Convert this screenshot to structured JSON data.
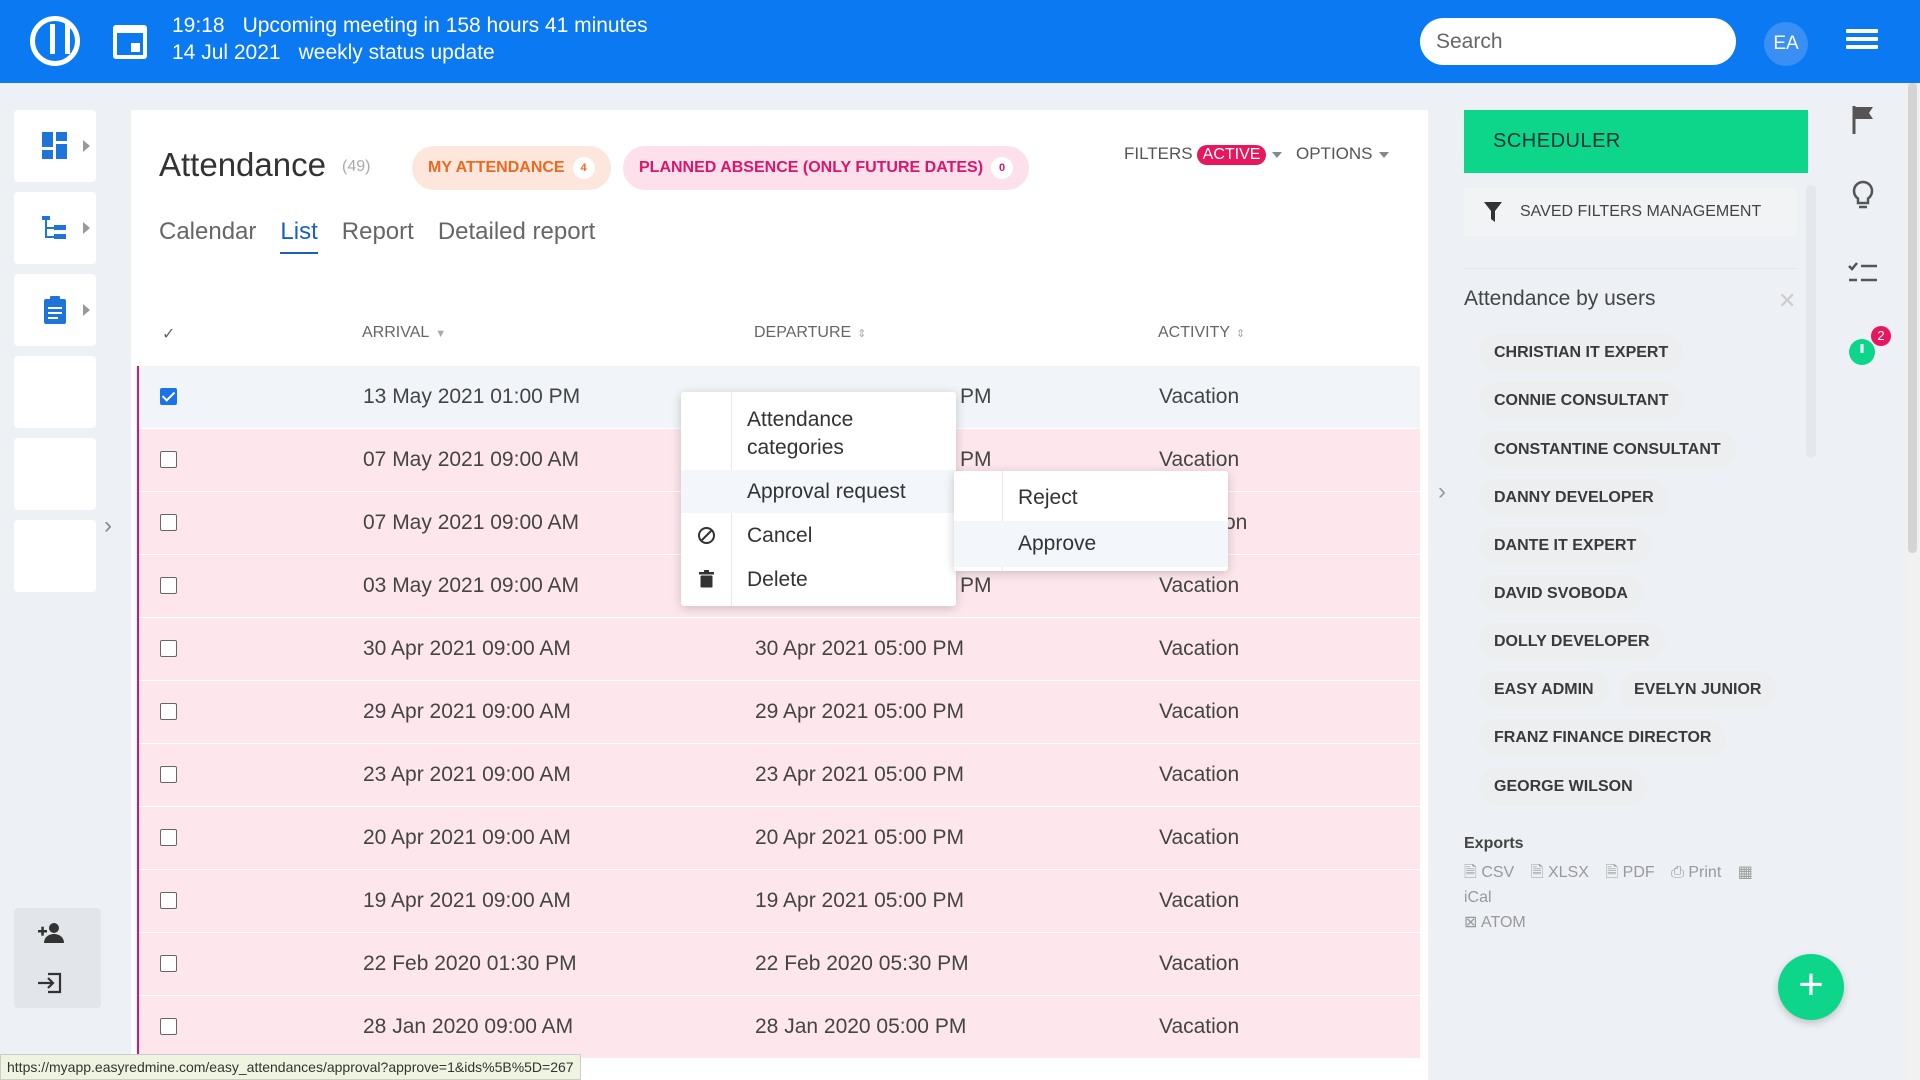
{
  "topbar": {
    "meeting_time": "19:18",
    "meeting_text": "Upcoming meeting in 158 hours 41 minutes",
    "meeting_date": "14 Jul 2021",
    "meeting_title": "weekly status update",
    "search_placeholder": "Search",
    "avatar_initials": "EA",
    "accent_color": "#0a79f2"
  },
  "page": {
    "title": "Attendance",
    "count": "(49)",
    "my_attendance_label": "MY ATTENDANCE",
    "my_attendance_count": "4",
    "planned_absence_label": "PLANNED ABSENCE (ONLY FUTURE DATES)",
    "planned_absence_count": "0",
    "filters_label": "FILTERS",
    "filters_badge": "ACTIVE",
    "options_label": "OPTIONS"
  },
  "tabs": [
    {
      "label": "Calendar",
      "active": false
    },
    {
      "label": "List",
      "active": true
    },
    {
      "label": "Report",
      "active": false
    },
    {
      "label": "Detailed report",
      "active": false
    }
  ],
  "table": {
    "check_header": "✓",
    "columns": [
      "ARRIVAL",
      "DEPARTURE",
      "ACTIVITY"
    ],
    "rows": [
      {
        "arrival": "13 May 2021 01:00 PM",
        "departure": "PM",
        "activity": "Vacation",
        "checked": true
      },
      {
        "arrival": "07 May 2021 09:00 AM",
        "departure": "PM",
        "activity": "Vacation",
        "checked": false
      },
      {
        "arrival": "07 May 2021 09:00 AM",
        "departure": "",
        "activity": "on",
        "checked": false
      },
      {
        "arrival": "03 May 2021 09:00 AM",
        "departure": "PM",
        "activity": "Vacation",
        "checked": false
      },
      {
        "arrival": "30 Apr 2021 09:00 AM",
        "departure": "30 Apr 2021 05:00 PM",
        "activity": "Vacation",
        "checked": false
      },
      {
        "arrival": "29 Apr 2021 09:00 AM",
        "departure": "29 Apr 2021 05:00 PM",
        "activity": "Vacation",
        "checked": false
      },
      {
        "arrival": "23 Apr 2021 09:00 AM",
        "departure": "23 Apr 2021 05:00 PM",
        "activity": "Vacation",
        "checked": false
      },
      {
        "arrival": "20 Apr 2021 09:00 AM",
        "departure": "20 Apr 2021 05:00 PM",
        "activity": "Vacation",
        "checked": false
      },
      {
        "arrival": "19 Apr 2021 09:00 AM",
        "departure": "19 Apr 2021 05:00 PM",
        "activity": "Vacation",
        "checked": false
      },
      {
        "arrival": "22 Feb 2020 01:30 PM",
        "departure": "22 Feb 2020 05:30 PM",
        "activity": "Vacation",
        "checked": false
      },
      {
        "arrival": "28 Jan 2020 09:00 AM",
        "departure": "28 Jan 2020 05:00 PM",
        "activity": "Vacation",
        "checked": false
      }
    ]
  },
  "context_menu": {
    "items": [
      "Attendance categories",
      "Approval request",
      "Cancel",
      "Delete"
    ],
    "categories_line1": "Attendance",
    "categories_line2": "categories",
    "submenu": [
      "Reject",
      "Approve"
    ]
  },
  "right_panel": {
    "scheduler_label": "SCHEDULER",
    "saved_filters_label": "SAVED FILTERS MANAGEMENT",
    "attendance_by_users_title": "Attendance by users",
    "users": [
      "CHRISTIAN IT EXPERT",
      "CONNIE CONSULTANT",
      "CONSTANTINE CONSULTANT",
      "DANNY DEVELOPER",
      "DANTE IT EXPERT",
      "DAVID SVOBODA",
      "DOLLY DEVELOPER",
      "EASY ADMIN",
      "EVELYN JUNIOR",
      "FRANZ FINANCE DIRECTOR",
      "GEORGE WILSON"
    ],
    "exports_title": "Exports",
    "exports": [
      "CSV",
      "XLSX",
      "PDF",
      "Print",
      "iCal",
      "ATOM"
    ],
    "timer_badge": "2"
  },
  "status_url": "https://myapp.easyredmine.com/easy_attendances/approval?approve=1&ids%5B%5D=267"
}
